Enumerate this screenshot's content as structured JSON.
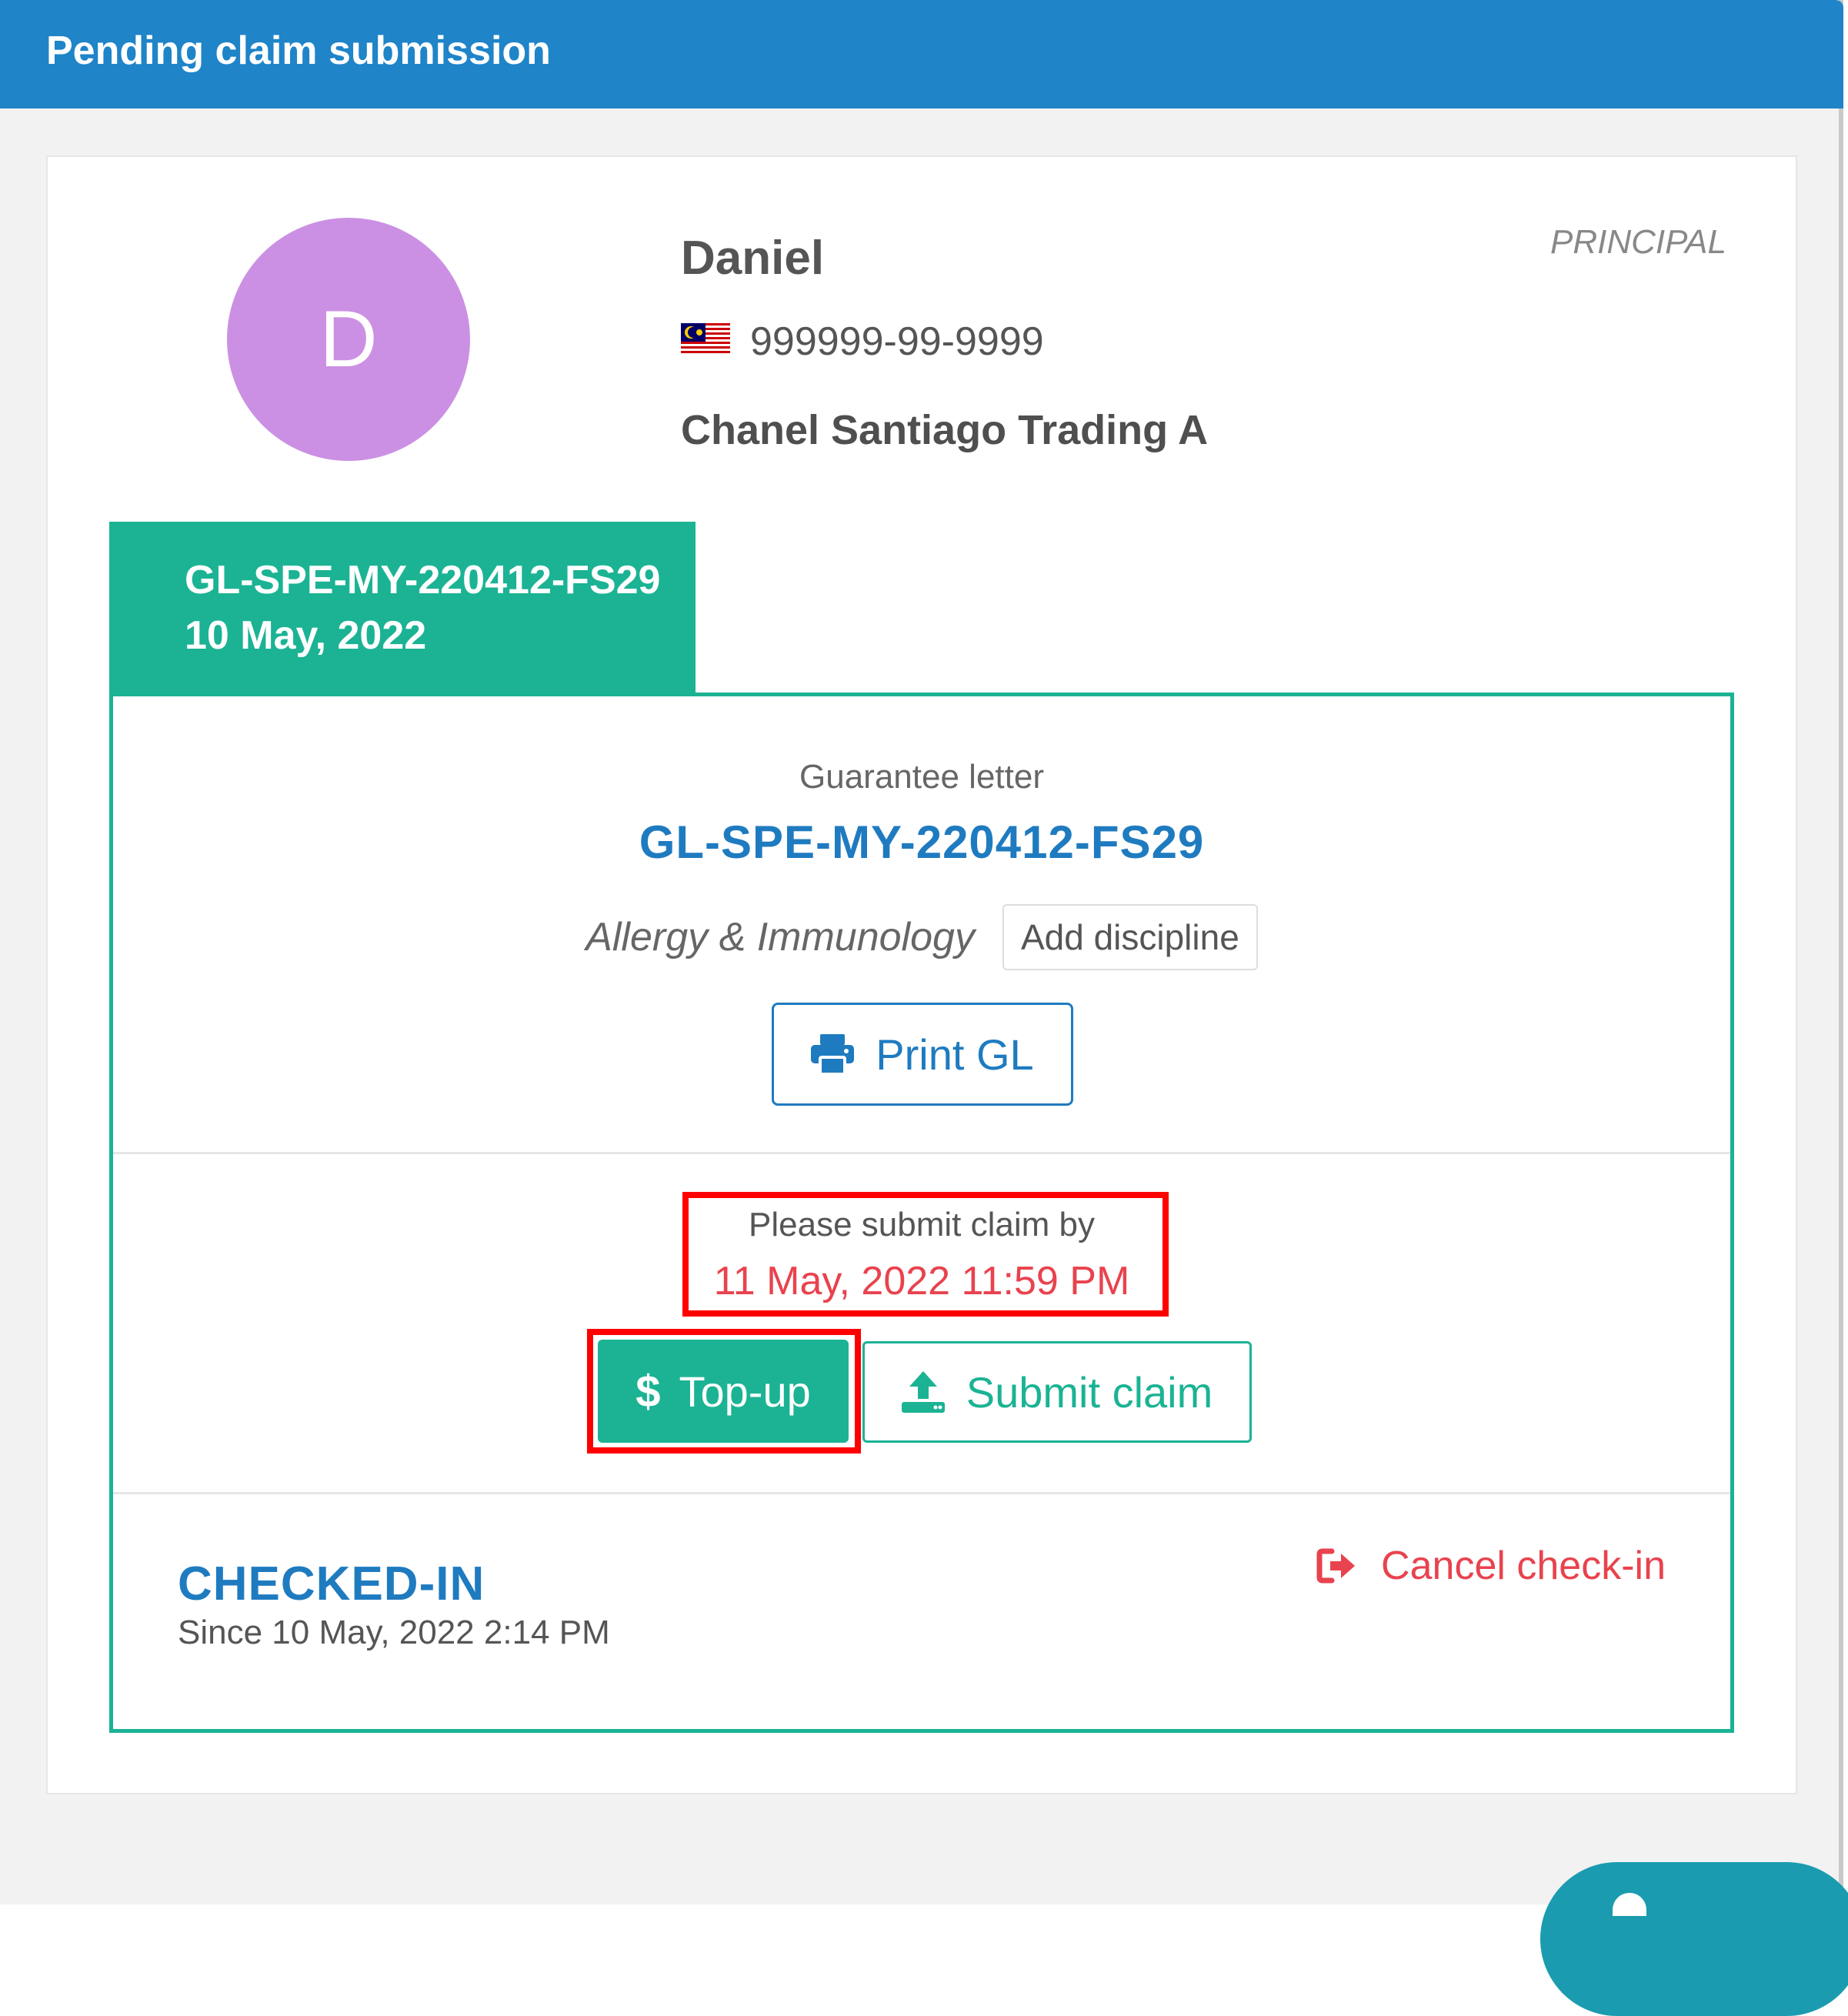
{
  "panel": {
    "title": "Pending claim submission"
  },
  "member": {
    "initial": "D",
    "name": "Daniel",
    "id_number": "999999-99-9999",
    "company": "Chanel Santiago Trading A",
    "role": "PRINCIPAL",
    "flag_icon": "malaysia-flag-icon",
    "avatar_color": "#cb90e3"
  },
  "gl_tab": {
    "code": "GL-SPE-MY-220412-FS29",
    "date": "10 May, 2022"
  },
  "guarantee_letter": {
    "label": "Guarantee letter",
    "number": "GL-SPE-MY-220412-FS29",
    "discipline": "Allergy & Immunology",
    "add_discipline_label": "Add discipline",
    "print_label": "Print GL"
  },
  "claim": {
    "deadline_label": "Please submit claim by",
    "deadline_value": "11 May, 2022 11:59 PM",
    "topup_label": "Top-up",
    "submit_label": "Submit claim"
  },
  "status": {
    "text": "CHECKED-IN",
    "since": "Since 10 May, 2022 2:14 PM",
    "cancel_label": "Cancel check-in"
  },
  "colors": {
    "header_blue": "#1f84c8",
    "accent_green": "#1bb394",
    "link_blue": "#1f7bc0",
    "alert_red": "#e8434e",
    "highlight_red": "#ff0000"
  }
}
